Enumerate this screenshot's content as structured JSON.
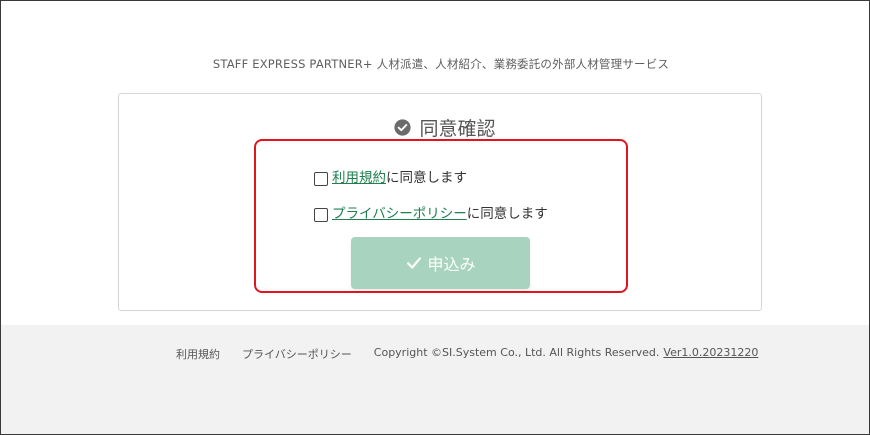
{
  "header": {
    "tagline": "STAFF EXPRESS PARTNER+ 人材派遣、人材紹介、業務委託の外部人材管理サービス"
  },
  "consent": {
    "title": "同意確認",
    "terms_link": "利用規約",
    "terms_suffix": "に同意します",
    "privacy_link": "プライバシーポリシー",
    "privacy_suffix": "に同意します",
    "terms_checked": false,
    "privacy_checked": false,
    "submit_label": "申込み",
    "submit_enabled": false,
    "accent_color": "#a8d4bf",
    "highlight_color": "#e0161f"
  },
  "footer": {
    "terms": "利用規約",
    "privacy": "プライバシーポリシー",
    "copyright": "Copyright ©SI.System Co., Ltd. All Rights Reserved.",
    "version": "Ver1.0.20231220"
  }
}
